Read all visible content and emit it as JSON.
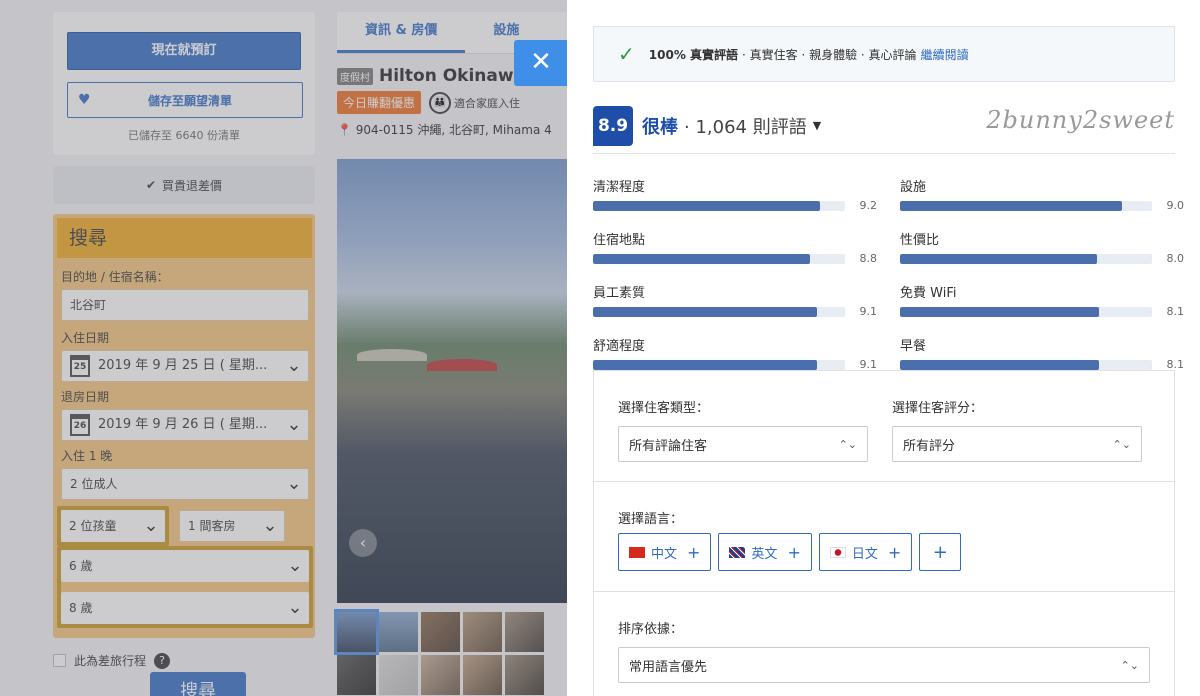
{
  "left_sidebar": {
    "book_now": "現在就預訂",
    "wishlist": "儲存至願望清單",
    "saved_count": "已儲存至 6640 份清單",
    "price_guarantee": "買貴退差價"
  },
  "search": {
    "title": "搜尋",
    "destination_label": "目的地 / 住宿名稱：",
    "destination_value": "北谷町",
    "checkin_label": "入住日期",
    "checkin_day": "25",
    "checkin_value": "2019 年 9 月 25 日 ( 星期...",
    "checkout_label": "退房日期",
    "checkout_day": "26",
    "checkout_value": "2019 年 9 月 26 日 ( 星期...",
    "nights_label": "入住 1 晚",
    "adults": "2 位成人",
    "children": "2 位孩童",
    "rooms": "1 間客房",
    "child_age_1": "6 歲",
    "child_age_2": "8 歲",
    "business_trip": "此為差旅行程",
    "search_button": "搜尋"
  },
  "hotel": {
    "tab_info": "資訊 & 房價",
    "tab_facilities": "設施",
    "type_tag": "度假村",
    "name": "Hilton Okinawa",
    "deal_badge": "今日賺翻優惠",
    "family_label": "適合家庭入住",
    "address": "904-0115 沖繩, 北谷町, Mihama 4"
  },
  "reviews": {
    "verified_bold": "100% 真實評語",
    "verified_text": "· 真實住客 · 親身體驗 · 真心評論",
    "verified_link": "繼續閱讀",
    "score": "8.9",
    "score_word": "很棒",
    "review_count": "· 1,064 則評語",
    "signature": "2bunny2sweet",
    "categories": [
      {
        "label": "清潔程度",
        "score": 9.2,
        "display": "9.2"
      },
      {
        "label": "設施",
        "score": 9.0,
        "display": "9.0"
      },
      {
        "label": "住宿地點",
        "score": 8.8,
        "display": "8.8"
      },
      {
        "label": "性價比",
        "score": 8.0,
        "display": "8.0"
      },
      {
        "label": "員工素質",
        "score": 9.1,
        "display": "9.1"
      },
      {
        "label": "免費 WiFi",
        "score": 8.1,
        "display": "8.1"
      },
      {
        "label": "舒適程度",
        "score": 9.1,
        "display": "9.1"
      },
      {
        "label": "早餐",
        "score": 8.1,
        "display": "8.1"
      }
    ],
    "filters": {
      "guest_type_label": "選擇住客類型：",
      "guest_type_value": "所有評論住客",
      "rating_label": "選擇住客評分：",
      "rating_value": "所有評分",
      "language_label": "選擇語言：",
      "languages": [
        "中文",
        "英文",
        "日文"
      ],
      "sort_label": "排序依據：",
      "sort_value": "常用語言優先"
    }
  },
  "colors": {
    "brand_blue": "#2f6bc4",
    "score_blue": "#1e4ea8",
    "bar_fill": "#4b6fad",
    "search_orange": "#f0a820"
  }
}
